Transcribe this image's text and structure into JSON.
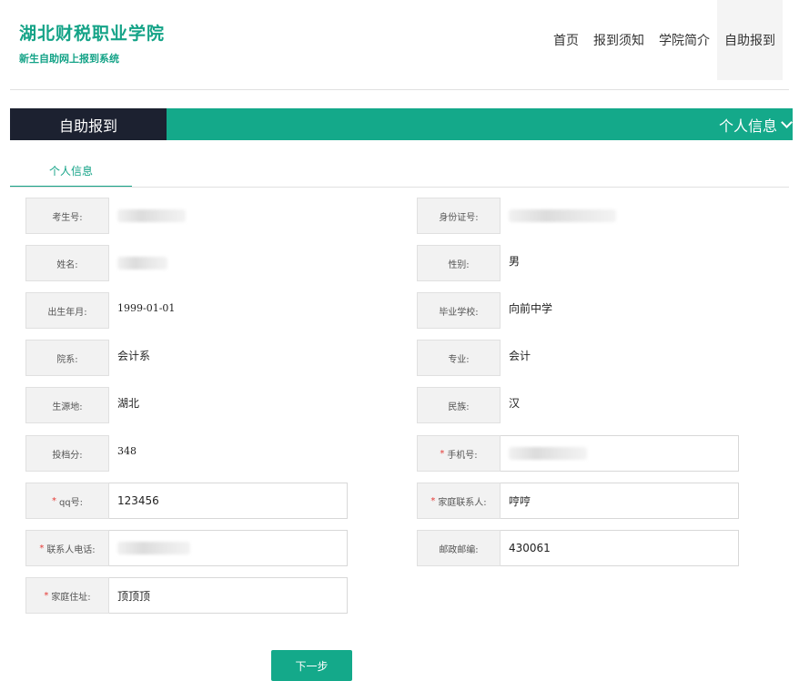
{
  "header": {
    "title": "湖北财税职业学院",
    "subtitle": "新生自助网上报到系统",
    "nav": [
      {
        "label": "首页"
      },
      {
        "label": "报到须知"
      },
      {
        "label": "学院简介"
      },
      {
        "label": "自助报到"
      }
    ]
  },
  "banner": {
    "left_label": "自助报到",
    "right_label": "个人信息"
  },
  "tabs": {
    "active_label": "个人信息"
  },
  "form": {
    "exam_no": {
      "label": "考生号:"
    },
    "id_no": {
      "label": "身份证号:"
    },
    "name": {
      "label": "姓名:"
    },
    "gender": {
      "label": "性别:",
      "value": "男"
    },
    "birth": {
      "label": "出生年月:",
      "value": "1999-01-01"
    },
    "school": {
      "label": "毕业学校:",
      "value": "向前中学"
    },
    "department": {
      "label": "院系:",
      "value": "会计系"
    },
    "major": {
      "label": "专业:",
      "value": "会计"
    },
    "origin": {
      "label": "生源地:",
      "value": "湖北"
    },
    "ethnicity": {
      "label": "民族:",
      "value": "汉"
    },
    "score": {
      "label": "投档分:",
      "value": "348"
    },
    "phone": {
      "label": "手机号:",
      "required_mark": "*"
    },
    "qq": {
      "label": "qq号:",
      "required_mark": "*",
      "value": "123456"
    },
    "family_contact": {
      "label": "家庭联系人:",
      "required_mark": "*",
      "value": "哼哼"
    },
    "contact_phone": {
      "label": "联系人电话:",
      "required_mark": "*"
    },
    "postcode": {
      "label": "邮政邮编:",
      "value": "430061"
    },
    "address": {
      "label": "家庭住址:",
      "required_mark": "*",
      "value": "顶顶顶"
    }
  },
  "actions": {
    "next_label": "下一步"
  },
  "colors": {
    "accent": "#14a98a",
    "dark": "#1c2130",
    "required": "#e53935"
  }
}
